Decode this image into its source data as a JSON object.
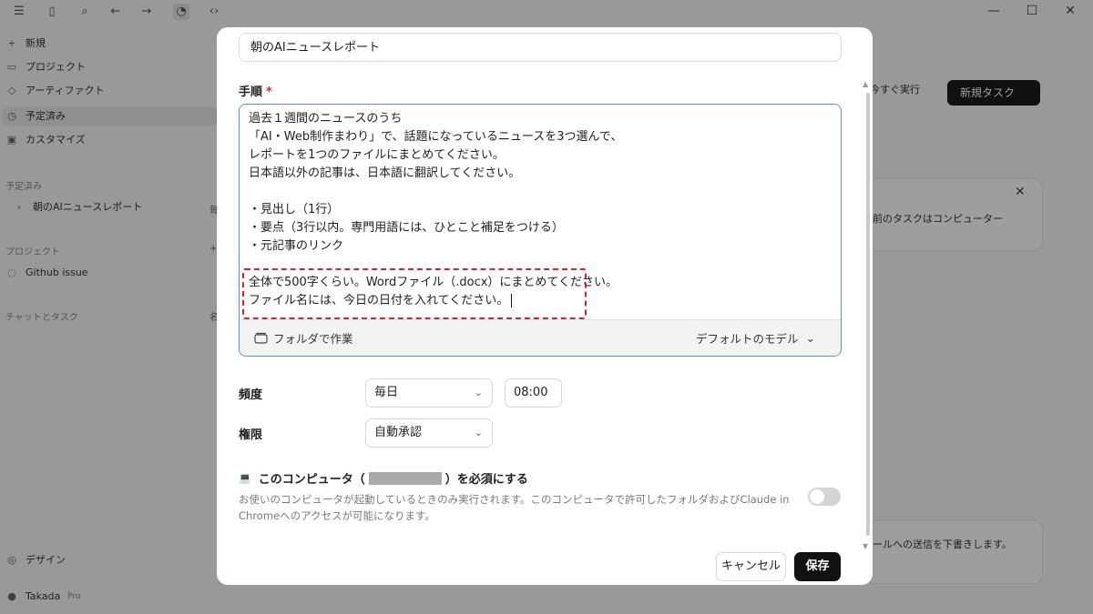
{
  "background": {
    "sidebar": {
      "items": [
        {
          "label": "新規",
          "icon": "plus-icon"
        },
        {
          "label": "プロジェクト",
          "icon": "folder-icon"
        },
        {
          "label": "アーティファクト",
          "icon": "artifact-icon"
        },
        {
          "label": "予定済み",
          "icon": "clock-icon"
        },
        {
          "label": "カスタマイズ",
          "icon": "customize-icon"
        }
      ],
      "scheduled_section": "予定済み",
      "scheduled_item": "朝のAIニュースレポート",
      "scheduled_item_right": "毎",
      "projects_section": "プロジェクト",
      "project_item": "Github issue",
      "chats_section": "チャットとタスク",
      "chats_right": "名",
      "design_item": "デザイン",
      "user_name": "Takada",
      "user_plan": "Pro"
    },
    "main": {
      "run_dropdown": "今すぐ実行",
      "new_task_button": "新規タスク",
      "info_text": "前のタスクはコンピューター",
      "bottom_text": "ールへの送信を下書きします。"
    }
  },
  "modal": {
    "task_name_value": "朝のAIニュースレポート",
    "steps": {
      "label": "手順",
      "required_mark": "*",
      "text": "過去１週間のニュースのうち\n「AI・Web制作まわり」で、話題になっているニュースを3つ選んで、\nレポートを1つのファイルにまとめてください。\n日本語以外の記事は、日本語に翻訳してください。\n\n・見出し（1行）\n・要点（3行以内。専門用語には、ひとこと補足をつける）\n・元記事のリンク\n\n全体で500字くらい。Wordファイル（.docx）にまとめてください。\nファイル名には、今日の日付を入れてください。",
      "folder_button": "フォルダで作業",
      "model_button": "デフォルトのモデル"
    },
    "frequency": {
      "label": "頻度",
      "value": "毎日",
      "time": "08:00"
    },
    "permission": {
      "label": "権限",
      "value": "自動承認"
    },
    "require_computer": {
      "label_prefix": "このコンピュータ（",
      "label_suffix": "）を必須にする",
      "description": "お使いのコンピュータが起動しているときのみ実行されます。このコンピュータで許可したフォルダおよびClaude in Chromeへのアクセスが可能になります。",
      "enabled": false
    },
    "cancel_button": "キャンセル",
    "save_button": "保存"
  }
}
